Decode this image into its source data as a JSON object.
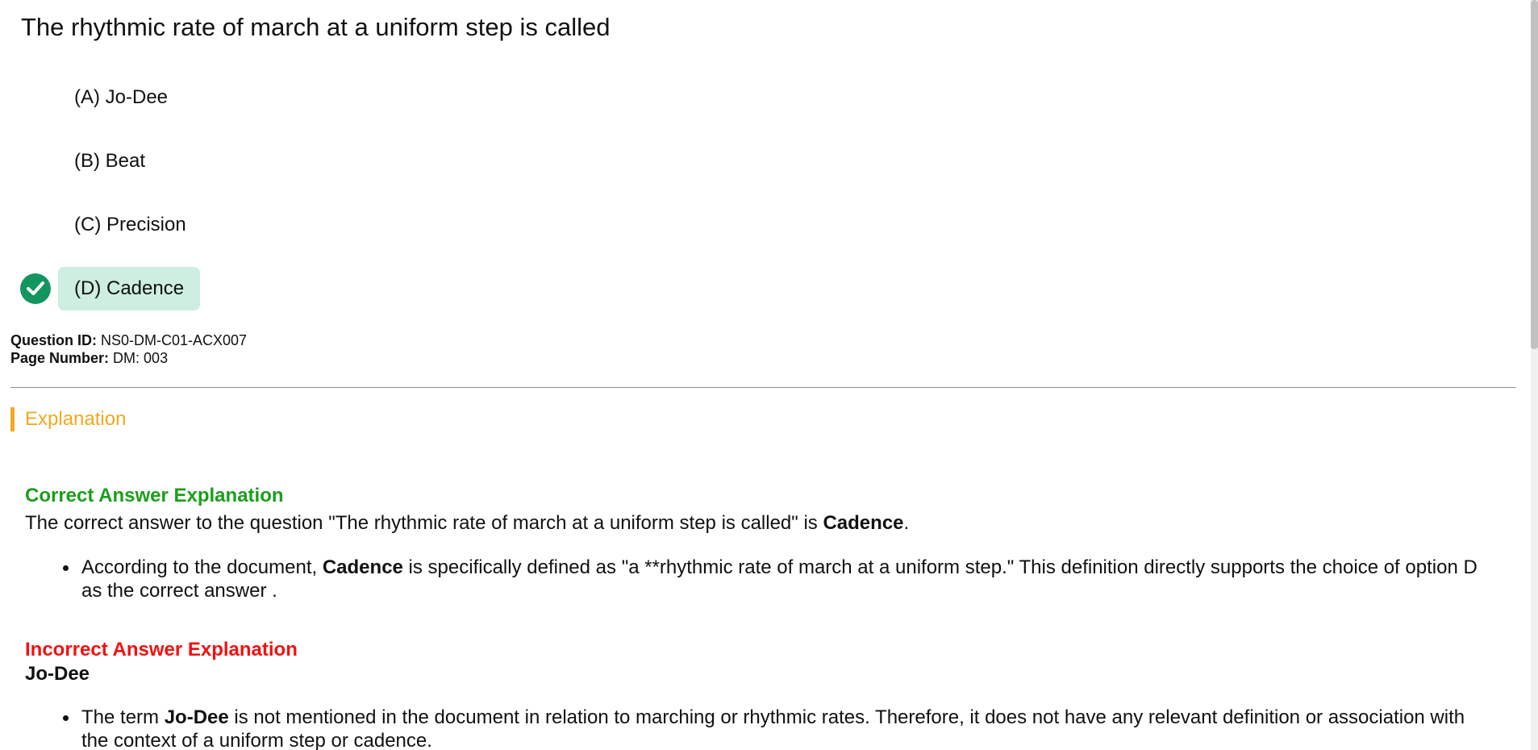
{
  "question": {
    "title": "The rhythmic rate of march at a uniform step is called",
    "options": [
      {
        "label": "(A) Jo-Dee",
        "correct": false
      },
      {
        "label": "(B) Beat",
        "correct": false
      },
      {
        "label": "(C) Precision",
        "correct": false
      },
      {
        "label": "(D) Cadence",
        "correct": true
      }
    ]
  },
  "meta": {
    "question_id_label": "Question ID:",
    "question_id": "NS0-DM-C01-ACX007",
    "page_number_label": "Page Number:",
    "page_number": "DM: 003"
  },
  "explanation": {
    "header": "Explanation",
    "correct_heading": "Correct Answer Explanation",
    "correct_paragraph": {
      "prefix": "The correct answer to the question \"The rhythmic rate of march at a uniform step is called\" is ",
      "bold": "Cadence",
      "suffix": "."
    },
    "correct_bullet": {
      "prefix": "According to the document, ",
      "bold": "Cadence",
      "suffix": " is specifically defined as \"a **rhythmic rate of march at a uniform step.\" This definition directly supports the choice of option D as the correct answer ."
    },
    "incorrect_heading": "Incorrect Answer Explanation",
    "incorrect_items": [
      {
        "title": "Jo-Dee",
        "bullet_prefix": "The term ",
        "bullet_bold": "Jo-Dee",
        "bullet_suffix": " is not mentioned in the document in relation to marching or rhythmic rates. Therefore, it does not have any relevant definition or association with the context of a uniform step or cadence."
      }
    ]
  },
  "colors": {
    "correct_option_bg": "#cdeee0",
    "check_badge": "#12955f",
    "explanation_accent": "#f1a922",
    "correct_heading": "#1a9f1a",
    "incorrect_heading": "#f21111"
  },
  "icons": {
    "correct_marker": "check-circle-icon"
  }
}
